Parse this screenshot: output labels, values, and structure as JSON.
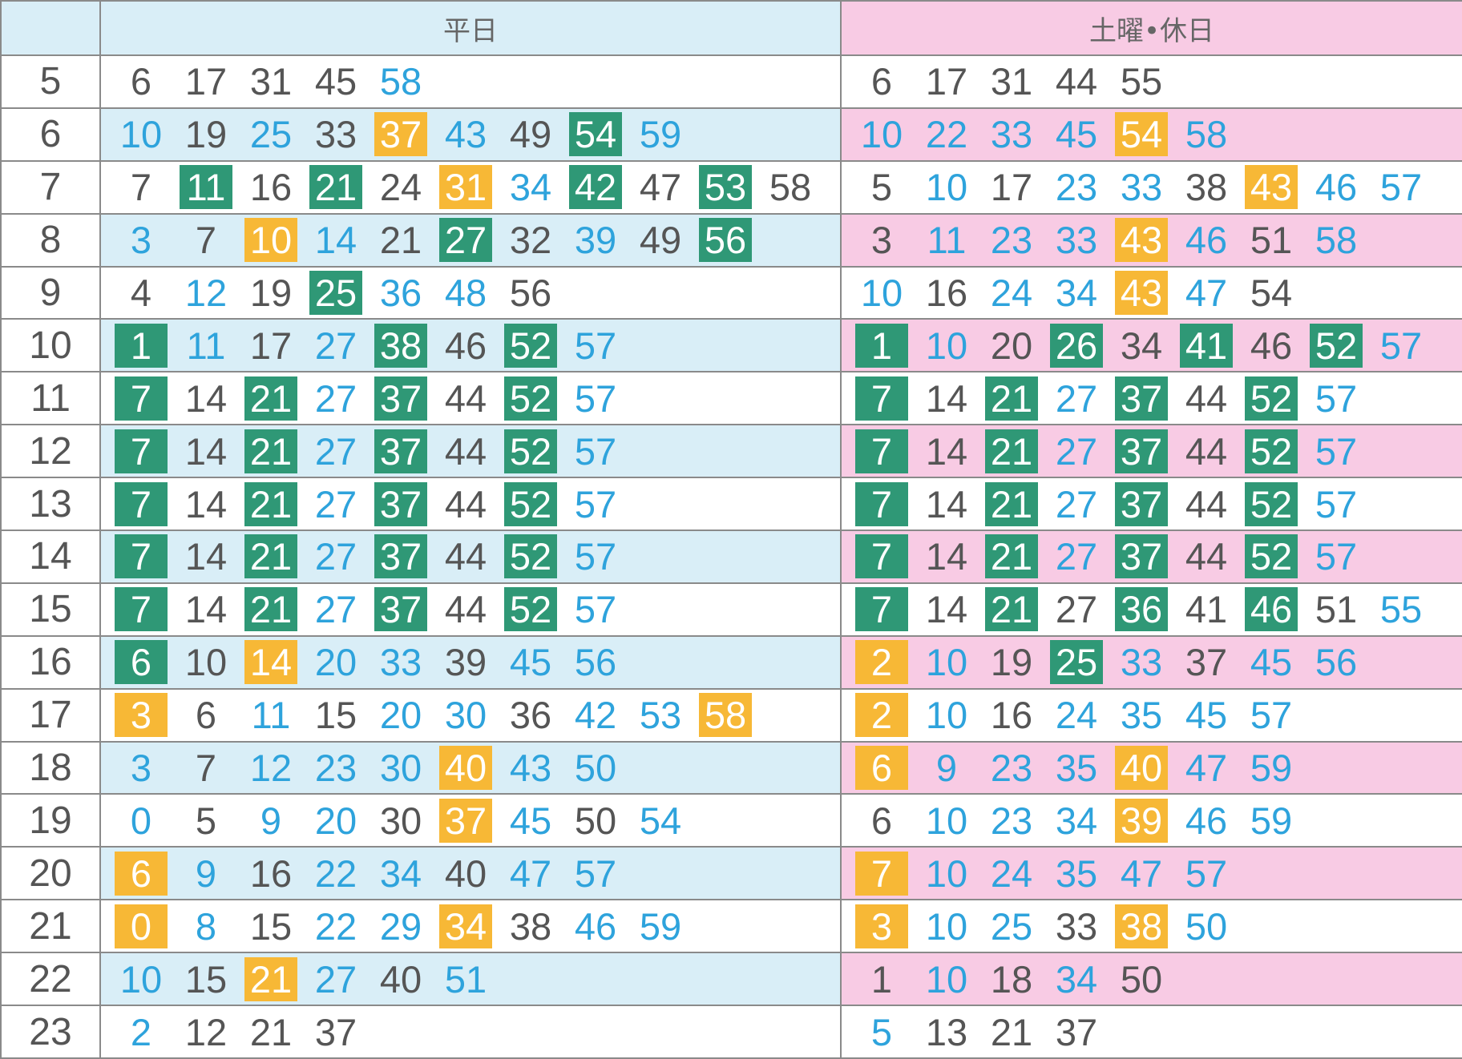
{
  "header": {
    "weekday": "平日",
    "holiday": "土曜•休日"
  },
  "legend": {
    "g": "#555555",
    "b": "#2ea3dc",
    "y": "#f7b836",
    "k": "#2f9876"
  },
  "rows": [
    {
      "hour": "5",
      "weekday": [
        [
          "6",
          "g"
        ],
        [
          "17",
          "g"
        ],
        [
          "31",
          "g"
        ],
        [
          "45",
          "g"
        ],
        [
          "58",
          "b"
        ]
      ],
      "holiday": [
        [
          "6",
          "g"
        ],
        [
          "17",
          "g"
        ],
        [
          "31",
          "g"
        ],
        [
          "44",
          "g"
        ],
        [
          "55",
          "g"
        ]
      ]
    },
    {
      "hour": "6",
      "weekday": [
        [
          "10",
          "b"
        ],
        [
          "19",
          "g"
        ],
        [
          "25",
          "b"
        ],
        [
          "33",
          "g"
        ],
        [
          "37",
          "y"
        ],
        [
          "43",
          "b"
        ],
        [
          "49",
          "g"
        ],
        [
          "54",
          "k"
        ],
        [
          "59",
          "b"
        ]
      ],
      "holiday": [
        [
          "10",
          "b"
        ],
        [
          "22",
          "b"
        ],
        [
          "33",
          "b"
        ],
        [
          "45",
          "b"
        ],
        [
          "54",
          "y"
        ],
        [
          "58",
          "b"
        ]
      ]
    },
    {
      "hour": "7",
      "weekday": [
        [
          "7",
          "g"
        ],
        [
          "11",
          "k"
        ],
        [
          "16",
          "g"
        ],
        [
          "21",
          "k"
        ],
        [
          "24",
          "g"
        ],
        [
          "31",
          "y"
        ],
        [
          "34",
          "b"
        ],
        [
          "42",
          "k"
        ],
        [
          "47",
          "g"
        ],
        [
          "53",
          "k"
        ],
        [
          "58",
          "g"
        ]
      ],
      "holiday": [
        [
          "5",
          "g"
        ],
        [
          "10",
          "b"
        ],
        [
          "17",
          "g"
        ],
        [
          "23",
          "b"
        ],
        [
          "33",
          "b"
        ],
        [
          "38",
          "g"
        ],
        [
          "43",
          "y"
        ],
        [
          "46",
          "b"
        ],
        [
          "57",
          "b"
        ]
      ]
    },
    {
      "hour": "8",
      "weekday": [
        [
          "3",
          "b"
        ],
        [
          "7",
          "g"
        ],
        [
          "10",
          "y"
        ],
        [
          "14",
          "b"
        ],
        [
          "21",
          "g"
        ],
        [
          "27",
          "k"
        ],
        [
          "32",
          "g"
        ],
        [
          "39",
          "b"
        ],
        [
          "49",
          "g"
        ],
        [
          "56",
          "k"
        ]
      ],
      "holiday": [
        [
          "3",
          "g"
        ],
        [
          "11",
          "b"
        ],
        [
          "23",
          "b"
        ],
        [
          "33",
          "b"
        ],
        [
          "43",
          "y"
        ],
        [
          "46",
          "b"
        ],
        [
          "51",
          "g"
        ],
        [
          "58",
          "b"
        ]
      ]
    },
    {
      "hour": "9",
      "weekday": [
        [
          "4",
          "g"
        ],
        [
          "12",
          "b"
        ],
        [
          "19",
          "g"
        ],
        [
          "25",
          "k"
        ],
        [
          "36",
          "b"
        ],
        [
          "48",
          "b"
        ],
        [
          "56",
          "g"
        ]
      ],
      "holiday": [
        [
          "10",
          "b"
        ],
        [
          "16",
          "g"
        ],
        [
          "24",
          "b"
        ],
        [
          "34",
          "b"
        ],
        [
          "43",
          "y"
        ],
        [
          "47",
          "b"
        ],
        [
          "54",
          "g"
        ]
      ]
    },
    {
      "hour": "10",
      "weekday": [
        [
          "1",
          "k"
        ],
        [
          "11",
          "b"
        ],
        [
          "17",
          "g"
        ],
        [
          "27",
          "b"
        ],
        [
          "38",
          "k"
        ],
        [
          "46",
          "g"
        ],
        [
          "52",
          "k"
        ],
        [
          "57",
          "b"
        ]
      ],
      "holiday": [
        [
          "1",
          "k"
        ],
        [
          "10",
          "b"
        ],
        [
          "20",
          "g"
        ],
        [
          "26",
          "k"
        ],
        [
          "34",
          "g"
        ],
        [
          "41",
          "k"
        ],
        [
          "46",
          "g"
        ],
        [
          "52",
          "k"
        ],
        [
          "57",
          "b"
        ]
      ]
    },
    {
      "hour": "11",
      "weekday": [
        [
          "7",
          "k"
        ],
        [
          "14",
          "g"
        ],
        [
          "21",
          "k"
        ],
        [
          "27",
          "b"
        ],
        [
          "37",
          "k"
        ],
        [
          "44",
          "g"
        ],
        [
          "52",
          "k"
        ],
        [
          "57",
          "b"
        ]
      ],
      "holiday": [
        [
          "7",
          "k"
        ],
        [
          "14",
          "g"
        ],
        [
          "21",
          "k"
        ],
        [
          "27",
          "b"
        ],
        [
          "37",
          "k"
        ],
        [
          "44",
          "g"
        ],
        [
          "52",
          "k"
        ],
        [
          "57",
          "b"
        ]
      ]
    },
    {
      "hour": "12",
      "weekday": [
        [
          "7",
          "k"
        ],
        [
          "14",
          "g"
        ],
        [
          "21",
          "k"
        ],
        [
          "27",
          "b"
        ],
        [
          "37",
          "k"
        ],
        [
          "44",
          "g"
        ],
        [
          "52",
          "k"
        ],
        [
          "57",
          "b"
        ]
      ],
      "holiday": [
        [
          "7",
          "k"
        ],
        [
          "14",
          "g"
        ],
        [
          "21",
          "k"
        ],
        [
          "27",
          "b"
        ],
        [
          "37",
          "k"
        ],
        [
          "44",
          "g"
        ],
        [
          "52",
          "k"
        ],
        [
          "57",
          "b"
        ]
      ]
    },
    {
      "hour": "13",
      "weekday": [
        [
          "7",
          "k"
        ],
        [
          "14",
          "g"
        ],
        [
          "21",
          "k"
        ],
        [
          "27",
          "b"
        ],
        [
          "37",
          "k"
        ],
        [
          "44",
          "g"
        ],
        [
          "52",
          "k"
        ],
        [
          "57",
          "b"
        ]
      ],
      "holiday": [
        [
          "7",
          "k"
        ],
        [
          "14",
          "g"
        ],
        [
          "21",
          "k"
        ],
        [
          "27",
          "b"
        ],
        [
          "37",
          "k"
        ],
        [
          "44",
          "g"
        ],
        [
          "52",
          "k"
        ],
        [
          "57",
          "b"
        ]
      ]
    },
    {
      "hour": "14",
      "weekday": [
        [
          "7",
          "k"
        ],
        [
          "14",
          "g"
        ],
        [
          "21",
          "k"
        ],
        [
          "27",
          "b"
        ],
        [
          "37",
          "k"
        ],
        [
          "44",
          "g"
        ],
        [
          "52",
          "k"
        ],
        [
          "57",
          "b"
        ]
      ],
      "holiday": [
        [
          "7",
          "k"
        ],
        [
          "14",
          "g"
        ],
        [
          "21",
          "k"
        ],
        [
          "27",
          "b"
        ],
        [
          "37",
          "k"
        ],
        [
          "44",
          "g"
        ],
        [
          "52",
          "k"
        ],
        [
          "57",
          "b"
        ]
      ]
    },
    {
      "hour": "15",
      "weekday": [
        [
          "7",
          "k"
        ],
        [
          "14",
          "g"
        ],
        [
          "21",
          "k"
        ],
        [
          "27",
          "b"
        ],
        [
          "37",
          "k"
        ],
        [
          "44",
          "g"
        ],
        [
          "52",
          "k"
        ],
        [
          "57",
          "b"
        ]
      ],
      "holiday": [
        [
          "7",
          "k"
        ],
        [
          "14",
          "g"
        ],
        [
          "21",
          "k"
        ],
        [
          "27",
          "g"
        ],
        [
          "36",
          "k"
        ],
        [
          "41",
          "g"
        ],
        [
          "46",
          "k"
        ],
        [
          "51",
          "g"
        ],
        [
          "55",
          "b"
        ]
      ]
    },
    {
      "hour": "16",
      "weekday": [
        [
          "6",
          "k"
        ],
        [
          "10",
          "g"
        ],
        [
          "14",
          "y"
        ],
        [
          "20",
          "b"
        ],
        [
          "33",
          "b"
        ],
        [
          "39",
          "g"
        ],
        [
          "45",
          "b"
        ],
        [
          "56",
          "b"
        ]
      ],
      "holiday": [
        [
          "2",
          "y"
        ],
        [
          "10",
          "b"
        ],
        [
          "19",
          "g"
        ],
        [
          "25",
          "k"
        ],
        [
          "33",
          "b"
        ],
        [
          "37",
          "g"
        ],
        [
          "45",
          "b"
        ],
        [
          "56",
          "b"
        ]
      ]
    },
    {
      "hour": "17",
      "weekday": [
        [
          "3",
          "y"
        ],
        [
          "6",
          "g"
        ],
        [
          "11",
          "b"
        ],
        [
          "15",
          "g"
        ],
        [
          "20",
          "b"
        ],
        [
          "30",
          "b"
        ],
        [
          "36",
          "g"
        ],
        [
          "42",
          "b"
        ],
        [
          "53",
          "b"
        ],
        [
          "58",
          "y"
        ]
      ],
      "holiday": [
        [
          "2",
          "y"
        ],
        [
          "10",
          "b"
        ],
        [
          "16",
          "g"
        ],
        [
          "24",
          "b"
        ],
        [
          "35",
          "b"
        ],
        [
          "45",
          "b"
        ],
        [
          "57",
          "b"
        ]
      ]
    },
    {
      "hour": "18",
      "weekday": [
        [
          "3",
          "b"
        ],
        [
          "7",
          "g"
        ],
        [
          "12",
          "b"
        ],
        [
          "23",
          "b"
        ],
        [
          "30",
          "b"
        ],
        [
          "40",
          "y"
        ],
        [
          "43",
          "b"
        ],
        [
          "50",
          "b"
        ]
      ],
      "holiday": [
        [
          "6",
          "y"
        ],
        [
          "9",
          "b"
        ],
        [
          "23",
          "b"
        ],
        [
          "35",
          "b"
        ],
        [
          "40",
          "y"
        ],
        [
          "47",
          "b"
        ],
        [
          "59",
          "b"
        ]
      ]
    },
    {
      "hour": "19",
      "weekday": [
        [
          "0",
          "b"
        ],
        [
          "5",
          "g"
        ],
        [
          "9",
          "b"
        ],
        [
          "20",
          "b"
        ],
        [
          "30",
          "g"
        ],
        [
          "37",
          "y"
        ],
        [
          "45",
          "b"
        ],
        [
          "50",
          "g"
        ],
        [
          "54",
          "b"
        ]
      ],
      "holiday": [
        [
          "6",
          "g"
        ],
        [
          "10",
          "b"
        ],
        [
          "23",
          "b"
        ],
        [
          "34",
          "b"
        ],
        [
          "39",
          "y"
        ],
        [
          "46",
          "b"
        ],
        [
          "59",
          "b"
        ]
      ]
    },
    {
      "hour": "20",
      "weekday": [
        [
          "6",
          "y"
        ],
        [
          "9",
          "b"
        ],
        [
          "16",
          "g"
        ],
        [
          "22",
          "b"
        ],
        [
          "34",
          "b"
        ],
        [
          "40",
          "g"
        ],
        [
          "47",
          "b"
        ],
        [
          "57",
          "b"
        ]
      ],
      "holiday": [
        [
          "7",
          "y"
        ],
        [
          "10",
          "b"
        ],
        [
          "24",
          "b"
        ],
        [
          "35",
          "b"
        ],
        [
          "47",
          "b"
        ],
        [
          "57",
          "b"
        ]
      ]
    },
    {
      "hour": "21",
      "weekday": [
        [
          "0",
          "y"
        ],
        [
          "8",
          "b"
        ],
        [
          "15",
          "g"
        ],
        [
          "22",
          "b"
        ],
        [
          "29",
          "b"
        ],
        [
          "34",
          "y"
        ],
        [
          "38",
          "g"
        ],
        [
          "46",
          "b"
        ],
        [
          "59",
          "b"
        ]
      ],
      "holiday": [
        [
          "3",
          "y"
        ],
        [
          "10",
          "b"
        ],
        [
          "25",
          "b"
        ],
        [
          "33",
          "g"
        ],
        [
          "38",
          "y"
        ],
        [
          "50",
          "b"
        ]
      ]
    },
    {
      "hour": "22",
      "weekday": [
        [
          "10",
          "b"
        ],
        [
          "15",
          "g"
        ],
        [
          "21",
          "y"
        ],
        [
          "27",
          "b"
        ],
        [
          "40",
          "g"
        ],
        [
          "51",
          "b"
        ]
      ],
      "holiday": [
        [
          "1",
          "g"
        ],
        [
          "10",
          "b"
        ],
        [
          "18",
          "g"
        ],
        [
          "34",
          "b"
        ],
        [
          "50",
          "g"
        ]
      ]
    },
    {
      "hour": "23",
      "weekday": [
        [
          "2",
          "b"
        ],
        [
          "12",
          "g"
        ],
        [
          "21",
          "g"
        ],
        [
          "37",
          "g"
        ]
      ],
      "holiday": [
        [
          "5",
          "b"
        ],
        [
          "13",
          "g"
        ],
        [
          "21",
          "g"
        ],
        [
          "37",
          "g"
        ]
      ]
    }
  ]
}
